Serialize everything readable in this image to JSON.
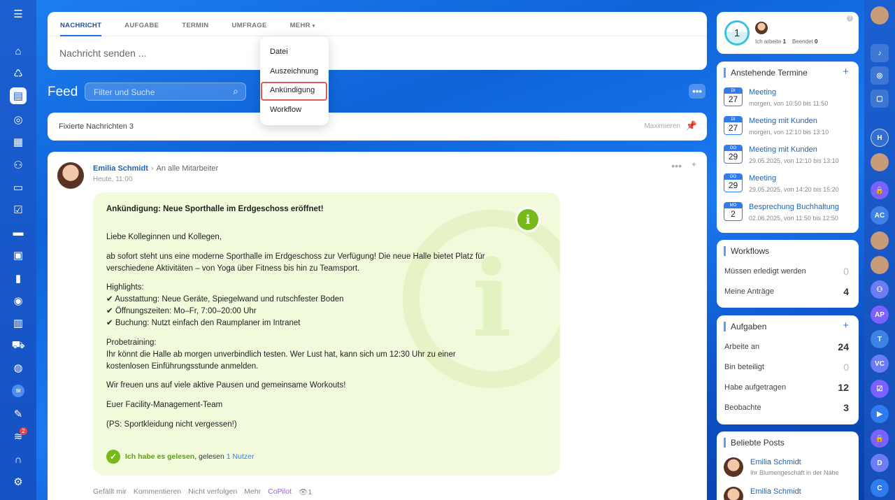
{
  "composer": {
    "tabs": [
      "NACHRICHT",
      "AUFGABE",
      "TERMIN",
      "UMFRAGE",
      "MEHR"
    ],
    "placeholder": "Nachricht senden ..."
  },
  "dropdown": {
    "items": [
      "Datei",
      "Auszeichnung",
      "Ankündigung",
      "Workflow"
    ]
  },
  "feed": {
    "title": "Feed",
    "filter_placeholder": "Filter und Suche",
    "more": "•••"
  },
  "pinned": {
    "label": "Fixierte Nachrichten 3",
    "maximize": "Maximieren"
  },
  "post": {
    "author": "Emilia Schmidt",
    "target": "An alle Mitarbeiter",
    "time": "Heute, 11:00",
    "announcement": {
      "title": "Ankündigung: Neue Sporthalle im Erdgeschoss eröffnet!",
      "greeting": "Liebe Kolleginnen und Kollegen,",
      "p1a": "ab sofort steht uns eine moderne Sporthalle im Erdgeschoss zur Verfügung! Die neue Halle bietet Platz für",
      "p1b": "verschiedene Aktivitäten – von Yoga über Fitness bis hin zu Teamsport.",
      "highlights": "Highlights:",
      "h1": "✔ Ausstattung: Neue Geräte, Spiegelwand und rutschfester Boden",
      "h2": "✔ Öffnungszeiten: Mo–Fr, 7:00–20:00 Uhr",
      "h3": "✔ Buchung: Nutzt einfach den Raumplaner im Intranet",
      "probe": "Probetraining:",
      "probe1": "Ihr könnt die Halle ab morgen unverbindlich testen. Wer Lust hat, kann sich um 12:30 Uhr zu einer",
      "probe2": "kostenlosen Einführungsstunde anmelden.",
      "closing": "Wir freuen uns auf viele aktive Pausen und gemeinsame Workouts!",
      "sign": "Euer Facility-Management-Team",
      "ps": "(PS: Sportkleidung nicht vergessen!)",
      "read_label": "Ich habe es gelesen",
      "read_by": ", gelesen",
      "read_count": "1 Nutzer"
    },
    "actions": [
      "Gefällt mir",
      "Kommentieren",
      "Nicht verfolgen",
      "Mehr",
      "CoPilot",
      "1"
    ]
  },
  "status": {
    "count": "1",
    "working_label": "Ich arbeite",
    "working": "1",
    "done_label": "Beendet",
    "done": "0"
  },
  "termine": {
    "title": "Anstehende Termine",
    "items": [
      {
        "day": "DI",
        "num": "27",
        "title": "Meeting",
        "sub": "morgen, von 10:50 bis 11:50"
      },
      {
        "day": "DI",
        "num": "27",
        "title": "Meeting mit Kunden",
        "sub": "morgen, von 12:10 bis 13:10"
      },
      {
        "day": "DO",
        "num": "29",
        "title": "Meeting mit Kunden",
        "sub": "29.05.2025, von 12:10 bis 13:10"
      },
      {
        "day": "DO",
        "num": "29",
        "title": "Meeting",
        "sub": "29.05.2025, von 14:20 bis 15:20"
      },
      {
        "day": "MO",
        "num": "2",
        "title": "Besprechung Buchhaltung",
        "sub": "02.06.2025, von 11:50 bis 12:50"
      }
    ]
  },
  "workflows": {
    "title": "Workflows",
    "rows": [
      {
        "label": "Müssen erledigt werden",
        "value": "0"
      },
      {
        "label": "Meine Anträge",
        "value": "4"
      }
    ]
  },
  "tasks": {
    "title": "Aufgaben",
    "rows": [
      {
        "label": "Arbeite an",
        "value": "24"
      },
      {
        "label": "Bin beteiligt",
        "value": "0"
      },
      {
        "label": "Habe aufgetragen",
        "value": "12"
      },
      {
        "label": "Beobachte",
        "value": "3"
      }
    ]
  },
  "posts": {
    "title": "Beliebte Posts",
    "items": [
      {
        "name": "Emilia Schmidt",
        "sub": "Ihr Blumengeschäft in der Nähe"
      },
      {
        "name": "Emilia Schmidt",
        "sub": ""
      }
    ]
  },
  "left_rail": {
    "avatar": "SI",
    "notif_badge": "2"
  },
  "right_rail": {
    "avatars": [
      "H",
      "AC",
      "AP",
      "T",
      "VC",
      "D",
      "C"
    ]
  }
}
